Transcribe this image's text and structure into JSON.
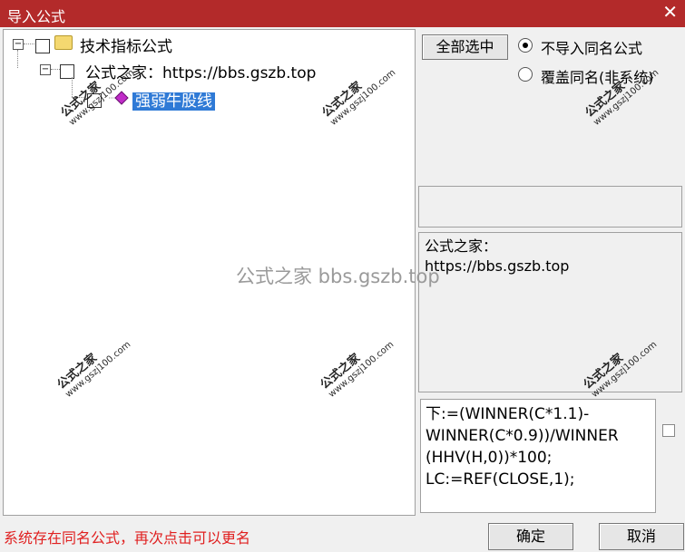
{
  "window": {
    "title": "导入公式",
    "close_glyph": "✕"
  },
  "tree": {
    "root": {
      "label": "技术指标公式",
      "expander": "−"
    },
    "source": {
      "label": "公式之家：https://bbs.gszb.top",
      "expander": "−"
    },
    "leaf": {
      "label": "强弱牛股线"
    }
  },
  "options": {
    "select_all": "全部选中",
    "radio_no_import": "不导入同名公式",
    "radio_overwrite": "覆盖同名(非系统)"
  },
  "description": {
    "line1": "公式之家：",
    "line2": "https://bbs.gszb.top"
  },
  "formula_text": [
    "下:=(WINNER(C*1.1)-",
    "WINNER(C*0.9))/WINNER",
    "(HHV(H,0))*100;",
    "LC:=REF(CLOSE,1);"
  ],
  "status_message": "系统存在同名公式，再次点击可以更名",
  "buttons": {
    "ok": "确定",
    "cancel": "取消"
  },
  "watermark": {
    "title": "公式之家",
    "url": "www.gszj100.com",
    "center": "公式之家 bbs.gszb.top"
  },
  "colors": {
    "titlebar": "#b32a2a",
    "selection": "#2f7ad6",
    "status": "#e02020"
  }
}
